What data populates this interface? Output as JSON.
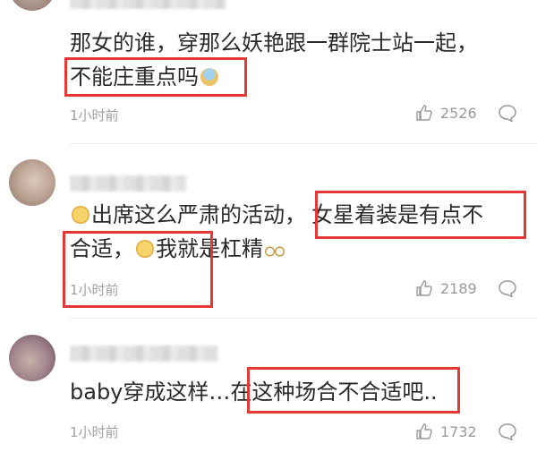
{
  "comments": [
    {
      "text_lines": [
        "那女的谁，穿那么妖艳跟一群院士站一起，",
        "不能庄重点吗"
      ],
      "time": "1小时前",
      "likes": "2526",
      "emoji": "cup-icon"
    },
    {
      "line1_prefix": "出席这么严肃的活动，",
      "line1_highlight": "女星着装是有点不",
      "line2_prefix": "合适，",
      "line2_suffix": "我就是杠精",
      "time": "1小时前",
      "likes": "2189"
    },
    {
      "text_prefix": "baby穿成这样…在",
      "text_highlight": "这种场合不合适吧..",
      "time": "1小时前",
      "likes": "1732"
    }
  ],
  "colors": {
    "highlight_border": "#e53935",
    "meta_gray": "#a0a0a0"
  }
}
